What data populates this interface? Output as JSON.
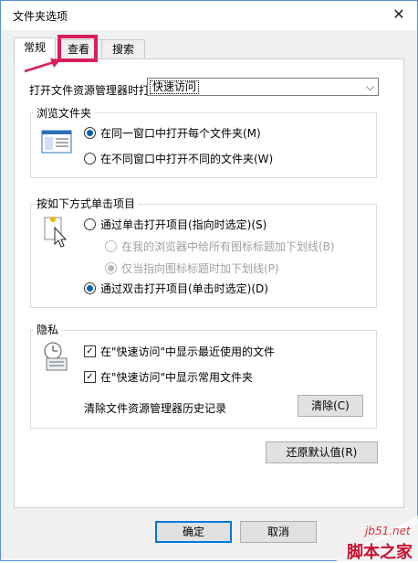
{
  "window": {
    "title": "文件夹选项",
    "close_glyph": "✕"
  },
  "tabs": [
    {
      "label": "常规"
    },
    {
      "label": "查看"
    },
    {
      "label": "搜索"
    }
  ],
  "open_explorer": {
    "label": "打开文件资源管理器时打",
    "value": "快速访问"
  },
  "browse": {
    "title": "浏览文件夹",
    "options": [
      {
        "label": "在同一窗口中打开每个文件夹(M)",
        "checked": true
      },
      {
        "label": "在不同窗口中打开不同的文件夹(W)",
        "checked": false
      }
    ]
  },
  "click": {
    "title": "按如下方式单击项目",
    "options": [
      {
        "label": "通过单击打开项目(指向时选定)(S)",
        "checked": false
      },
      {
        "label": "在我的浏览器中给所有图标标题加下划线(B)",
        "checked": false,
        "disabled": true
      },
      {
        "label": "仅当指向图标标题时加下划线(P)",
        "checked": true,
        "disabled": true
      },
      {
        "label": "通过双击打开项目(单击时选定)(D)",
        "checked": true
      }
    ]
  },
  "privacy": {
    "title": "隐私",
    "checks": [
      {
        "label": "在\"快速访问\"中显示最近使用的文件",
        "checked": true
      },
      {
        "label": "在\"快速访问\"中显示常用文件夹",
        "checked": true
      }
    ],
    "clear_text": "清除文件资源管理器历史记录",
    "clear_button": "清除(C)"
  },
  "restore_button": "还原默认值(R)",
  "footer": {
    "ok": "确定",
    "cancel": "取消"
  },
  "watermark": {
    "site": "jb51.net",
    "brand": "脚本之家"
  },
  "colors": {
    "highlight": "#d81e5b",
    "accent": "#0078d7"
  }
}
